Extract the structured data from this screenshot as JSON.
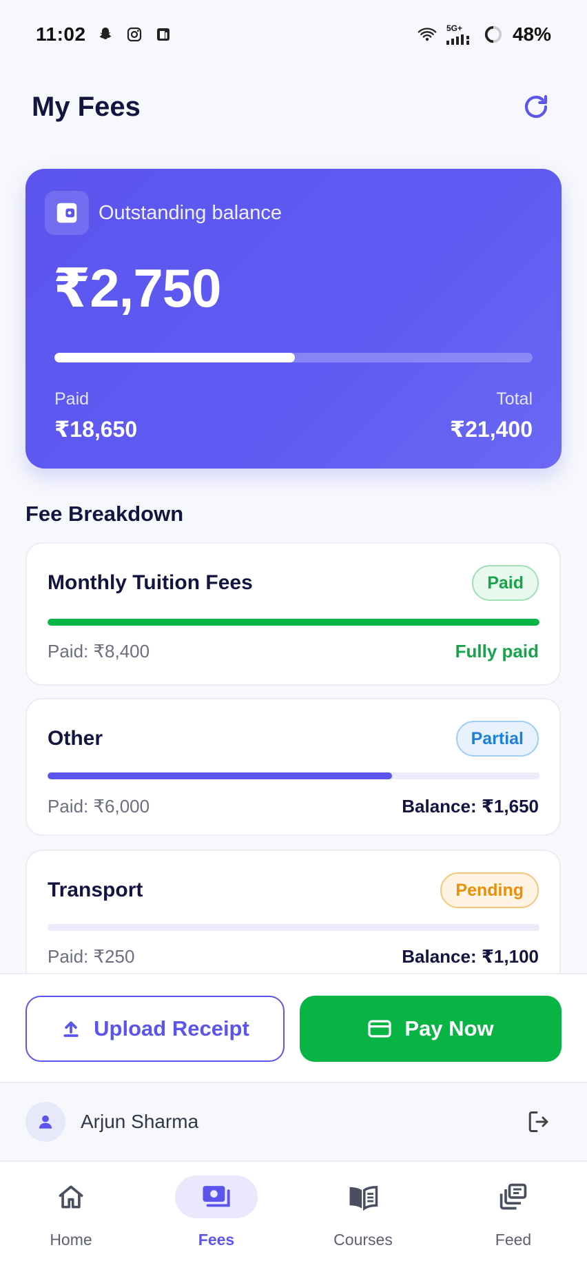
{
  "status_bar": {
    "time": "11:02",
    "network": "5G+",
    "battery": "48%"
  },
  "header": {
    "title": "My Fees",
    "refresh_icon": "refresh-icon"
  },
  "balance_card": {
    "label": "Outstanding balance",
    "amount": "₹2,750",
    "paid_label": "Paid",
    "paid_amount": "₹18,650",
    "total_label": "Total",
    "total_amount": "₹21,400",
    "progress_fraction": 0.503,
    "icon": "wallet-icon"
  },
  "fee_breakdown": {
    "title": "Fee Breakdown",
    "items": [
      {
        "name": "Monthly Tuition Fees",
        "status": "Paid",
        "paid_text": "Paid: ₹8,400",
        "right_text": "Fully paid",
        "progress_fraction": 1.0
      },
      {
        "name": "Other",
        "status": "Partial",
        "paid_text": "Paid: ₹6,000",
        "right_text": "Balance: ₹1,650",
        "progress_fraction": 0.7
      },
      {
        "name": "Transport",
        "status": "Pending",
        "paid_text": "Paid: ₹250",
        "right_text": "Balance: ₹1,100",
        "progress_fraction": 0.0
      }
    ]
  },
  "actions": {
    "upload_label": "Upload Receipt",
    "pay_label": "Pay Now"
  },
  "user": {
    "name": "Arjun Sharma"
  },
  "bottom_nav": {
    "items": [
      {
        "label": "Home",
        "icon": "home-icon"
      },
      {
        "label": "Fees",
        "icon": "fees-icon",
        "active": true
      },
      {
        "label": "Courses",
        "icon": "book-icon"
      },
      {
        "label": "Feed",
        "icon": "feed-icon"
      }
    ]
  },
  "colors": {
    "primary": "#5b55ee",
    "success": "#08b544",
    "partial": "#1d7fd8",
    "pending": "#e8900c",
    "title": "#141440"
  }
}
